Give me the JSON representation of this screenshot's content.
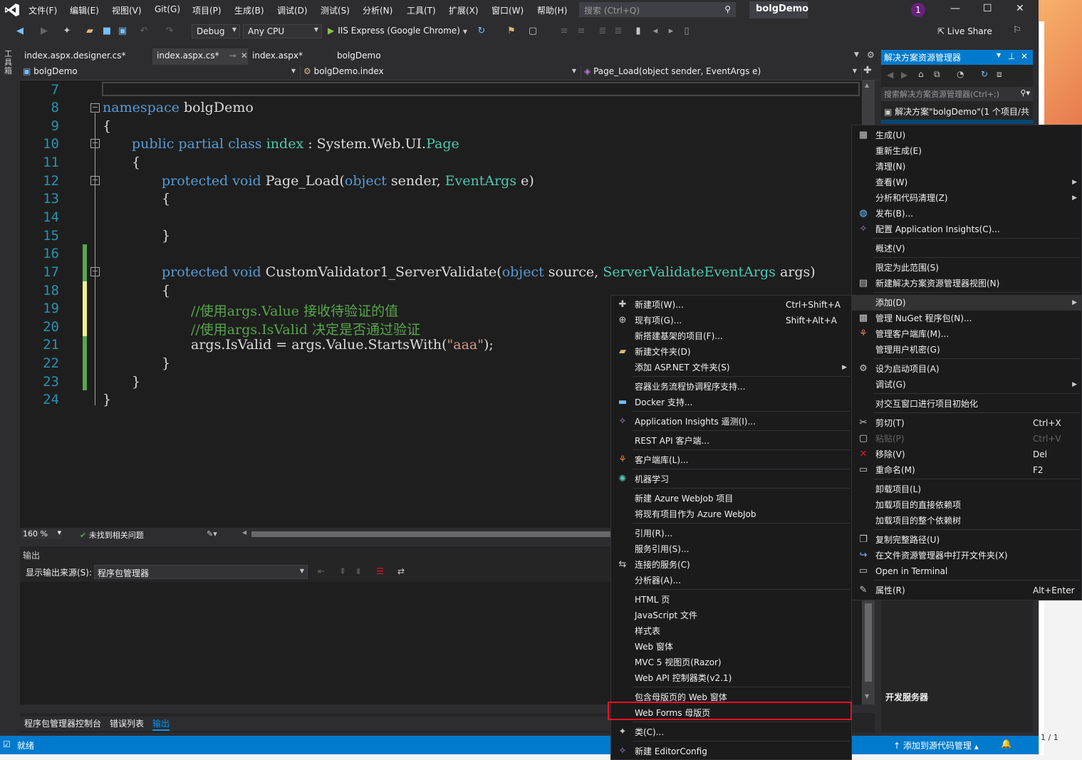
{
  "menubar": {
    "items": [
      "文件(F)",
      "编辑(E)",
      "视图(V)",
      "Git(G)",
      "项目(P)",
      "生成(B)",
      "调试(D)",
      "测试(S)",
      "分析(N)",
      "工具(T)",
      "扩展(X)",
      "窗口(W)",
      "帮助(H)"
    ],
    "search_placeholder": "搜索 (Ctrl+Q)",
    "app_title": "bolgDemo",
    "notification_count": "1"
  },
  "toolbar": {
    "config": "Debug",
    "platform": "Any CPU",
    "run_label": "IIS Express (Google Chrome)",
    "live_share": "Live Share"
  },
  "left_strip_label": "工具箱",
  "tabs": [
    "index.aspx.designer.cs*",
    "index.aspx.cs*",
    "index.aspx*",
    "bolgDemo"
  ],
  "navbar": {
    "project": "bolgDemo",
    "class": "bolgDemo.index",
    "member": "Page_Load(object sender, EventArgs e)"
  },
  "code": {
    "line_numbers": [
      "7",
      "8",
      "9",
      "10",
      "11",
      "12",
      "13",
      "14",
      "15",
      "16",
      "17",
      "18",
      "19",
      "20",
      "21",
      "22",
      "23",
      "24"
    ],
    "ns_kw": "namespace",
    "ns_name": "bolgDemo",
    "brace_open": "{",
    "brace_close": "}",
    "class_mods": "public partial class",
    "class_name": "index",
    "class_colon": " : ",
    "class_base_ns": "System.Web.UI.",
    "class_base": "Page",
    "m1_mods": "protected void",
    "m1_name": "Page_Load(",
    "m1_p1t": "object",
    "m1_p1": " sender, ",
    "m1_p2t": "EventArgs",
    "m1_p2": " e)",
    "m2_mods": "protected void",
    "m2_name": "CustomValidator1_ServerValidate(",
    "m2_p1t": "object",
    "m2_p1": " source, ",
    "m2_p2t": "ServerValidateEventArgs",
    "m2_p2": " args)",
    "comment1": "//使用args.Value 接收待验证的值",
    "comment2": "//使用args.IsValid 决定是否通过验证",
    "stmt_pre": "args.IsValid = args.Value.StartsWith(",
    "stmt_str": "\"aaa\"",
    "stmt_post": ");"
  },
  "editor_status": {
    "zoom": "160 %",
    "issues": "未找到相关问题"
  },
  "output": {
    "title": "输出",
    "source_label": "显示输出来源(S):",
    "source_value": "程序包管理器"
  },
  "bottom_tabs": [
    "程序包管理器控制台",
    "错误列表",
    "输出"
  ],
  "statusbar": {
    "ready": "就绪",
    "source_control": "添加到源代码管理"
  },
  "solution_explorer": {
    "title": "解决方案资源管理器",
    "search_placeholder": "搜索解决方案资源管理器(Ctrl+;)",
    "root": "解决方案\"bolgDemo\"(1 个项目/共",
    "dev_server": "开发服务器",
    "page_indicator": "1 / 1"
  },
  "context_menu": [
    {
      "icon": "build-icon",
      "label": "生成(U)"
    },
    {
      "icon": "",
      "label": "重新生成(E)"
    },
    {
      "icon": "",
      "label": "清理(N)"
    },
    {
      "icon": "",
      "label": "查看(W)",
      "sub": true
    },
    {
      "icon": "",
      "label": "分析和代码清理(Z)",
      "sub": true
    },
    {
      "icon": "globe-icon",
      "label": "发布(B)..."
    },
    {
      "icon": "bulb-icon",
      "label": "配置 Application Insights(C)..."
    },
    {
      "icon": "",
      "label": "概述(V)"
    },
    {
      "icon": "",
      "label": "限定为此范围(S)"
    },
    {
      "icon": "new-view-icon",
      "label": "新建解决方案资源管理器视图(N)"
    },
    {
      "icon": "",
      "label": "添加(D)",
      "sub": true
    },
    {
      "icon": "nuget-icon",
      "label": "管理 NuGet 程序包(N)..."
    },
    {
      "icon": "client-lib-icon",
      "label": "管理客户端库(M)..."
    },
    {
      "icon": "",
      "label": "管理用户机密(G)"
    },
    {
      "icon": "gear-icon",
      "label": "设为启动项目(A)"
    },
    {
      "icon": "",
      "label": "调试(G)",
      "sub": true
    },
    {
      "icon": "",
      "label": "对交互窗口进行项目初始化"
    },
    {
      "icon": "cut-icon",
      "label": "剪切(T)",
      "shortcut": "Ctrl+X"
    },
    {
      "icon": "paste-icon",
      "label": "粘贴(P)",
      "shortcut": "Ctrl+V",
      "disabled": true
    },
    {
      "icon": "remove-icon",
      "label": "移除(V)",
      "shortcut": "Del"
    },
    {
      "icon": "rename-icon",
      "label": "重命名(M)",
      "shortcut": "F2"
    },
    {
      "icon": "",
      "label": "卸载项目(L)"
    },
    {
      "icon": "",
      "label": "加载项目的直接依赖项"
    },
    {
      "icon": "",
      "label": "加载项目的整个依赖树"
    },
    {
      "icon": "copy-icon",
      "label": "复制完整路径(U)"
    },
    {
      "icon": "open-folder-icon",
      "label": "在文件资源管理器中打开文件夹(X)"
    },
    {
      "icon": "terminal-icon",
      "label": "Open in Terminal"
    },
    {
      "icon": "wrench-icon",
      "label": "属性(R)",
      "shortcut": "Alt+Enter"
    }
  ],
  "add_submenu": [
    {
      "icon": "new-item-icon",
      "label": "新建项(W)...",
      "shortcut": "Ctrl+Shift+A"
    },
    {
      "icon": "existing-item-icon",
      "label": "现有项(G)...",
      "shortcut": "Shift+Alt+A"
    },
    {
      "icon": "",
      "label": "新搭建基架的项目(F)..."
    },
    {
      "icon": "new-folder-icon",
      "label": "新建文件夹(D)"
    },
    {
      "icon": "",
      "label": "添加 ASP.NET 文件夹(S)",
      "sub": true
    },
    {
      "icon": "",
      "label": "容器业务流程协调程序支持..."
    },
    {
      "icon": "docker-icon",
      "label": "Docker 支持..."
    },
    {
      "icon": "bulb-icon",
      "label": "Application Insights 遥测(I)..."
    },
    {
      "icon": "",
      "label": "REST API 客户端..."
    },
    {
      "icon": "client-lib-icon",
      "label": "客户端库(L)..."
    },
    {
      "icon": "ml-icon",
      "label": "机器学习"
    },
    {
      "icon": "",
      "label": "新建 Azure WebJob 项目"
    },
    {
      "icon": "",
      "label": "将现有项目作为 Azure WebJob"
    },
    {
      "icon": "",
      "label": "引用(R)..."
    },
    {
      "icon": "",
      "label": "服务引用(S)..."
    },
    {
      "icon": "connected-service-icon",
      "label": "连接的服务(C)"
    },
    {
      "icon": "",
      "label": "分析器(A)..."
    },
    {
      "icon": "",
      "label": "HTML 页"
    },
    {
      "icon": "",
      "label": "JavaScript 文件"
    },
    {
      "icon": "",
      "label": "样式表"
    },
    {
      "icon": "",
      "label": "Web 窗体"
    },
    {
      "icon": "",
      "label": "MVC 5 视图页(Razor)"
    },
    {
      "icon": "",
      "label": "Web API 控制器类(v2.1)"
    },
    {
      "icon": "",
      "label": "包含母版页的 Web 窗体"
    },
    {
      "icon": "",
      "label": "Web Forms 母版页"
    },
    {
      "icon": "class-icon",
      "label": "类(C)..."
    },
    {
      "icon": "bulb-icon",
      "label": "新建 EditorConfig"
    }
  ]
}
